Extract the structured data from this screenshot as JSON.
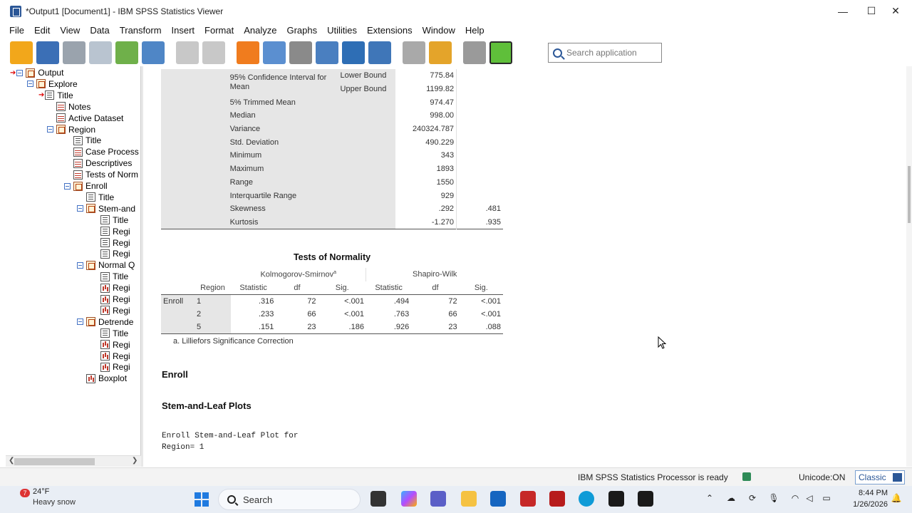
{
  "window": {
    "title": "*Output1 [Document1] - IBM SPSS Statistics Viewer",
    "minimize": "—",
    "maximize": "☐",
    "close": "✕"
  },
  "menu": [
    "File",
    "Edit",
    "View",
    "Data",
    "Transform",
    "Insert",
    "Format",
    "Analyze",
    "Graphs",
    "Utilities",
    "Extensions",
    "Window",
    "Help"
  ],
  "toolbar": {
    "search_placeholder": "Search application",
    "icons": [
      "open-folder-icon",
      "save-icon",
      "print-icon",
      "print-preview-icon",
      "export-icon",
      "recall-dialog-icon",
      "undo-icon",
      "redo-icon",
      "goto-data-icon",
      "goto-case-icon",
      "variables-icon",
      "split-file-icon",
      "select-cases-icon",
      "value-labels-icon",
      "designate-window-icon",
      "show-all-icon",
      "hide-icon",
      "insert-output-icon"
    ]
  },
  "outline": {
    "items": [
      {
        "label": "Output",
        "type": "book",
        "level": 0,
        "expander": true,
        "arrow": true
      },
      {
        "label": "Explore",
        "type": "book",
        "level": 1,
        "expander": true
      },
      {
        "label": "Title",
        "type": "page",
        "level": 2,
        "arrow": true
      },
      {
        "label": "Notes",
        "type": "tbl",
        "level": 2
      },
      {
        "label": "Active Dataset",
        "type": "tbl",
        "level": 2
      },
      {
        "label": "Region",
        "type": "book",
        "level": 2,
        "expander": true
      },
      {
        "label": "Title",
        "type": "page",
        "level": 3
      },
      {
        "label": "Case Process",
        "type": "tbl",
        "level": 3
      },
      {
        "label": "Descriptives",
        "type": "tbl",
        "level": 3
      },
      {
        "label": "Tests of Norm",
        "type": "tbl",
        "level": 3
      },
      {
        "label": "Enroll",
        "type": "book",
        "level": 3,
        "expander": true
      },
      {
        "label": "Title",
        "type": "page",
        "level": 4
      },
      {
        "label": "Stem-and",
        "type": "book",
        "level": 4,
        "expander": true
      },
      {
        "label": "Title",
        "type": "page",
        "level": 5
      },
      {
        "label": "Regi",
        "type": "page",
        "level": 5
      },
      {
        "label": "Regi",
        "type": "page",
        "level": 5
      },
      {
        "label": "Regi",
        "type": "page",
        "level": 5
      },
      {
        "label": "Normal Q",
        "type": "book",
        "level": 4,
        "expander": true
      },
      {
        "label": "Title",
        "type": "page",
        "level": 5
      },
      {
        "label": "Regi",
        "type": "chart",
        "level": 5
      },
      {
        "label": "Regi",
        "type": "chart",
        "level": 5
      },
      {
        "label": "Regi",
        "type": "chart",
        "level": 5
      },
      {
        "label": "Detrende",
        "type": "book",
        "level": 4,
        "expander": true
      },
      {
        "label": "Title",
        "type": "page",
        "level": 5
      },
      {
        "label": "Regi",
        "type": "chart",
        "level": 5
      },
      {
        "label": "Regi",
        "type": "chart",
        "level": 5
      },
      {
        "label": "Regi",
        "type": "chart",
        "level": 5
      },
      {
        "label": "Boxplot",
        "type": "chart",
        "level": 4
      }
    ]
  },
  "descriptives": {
    "rows": [
      {
        "label": "95% Confidence Interval for Mean",
        "sub": "Lower Bound",
        "stat": "775.84",
        "se": ""
      },
      {
        "label": "",
        "sub": "Upper Bound",
        "stat": "1199.82",
        "se": ""
      },
      {
        "label": "5% Trimmed Mean",
        "sub": "",
        "stat": "974.47",
        "se": ""
      },
      {
        "label": "Median",
        "sub": "",
        "stat": "998.00",
        "se": ""
      },
      {
        "label": "Variance",
        "sub": "",
        "stat": "240324.787",
        "se": ""
      },
      {
        "label": "Std. Deviation",
        "sub": "",
        "stat": "490.229",
        "se": ""
      },
      {
        "label": "Minimum",
        "sub": "",
        "stat": "343",
        "se": ""
      },
      {
        "label": "Maximum",
        "sub": "",
        "stat": "1893",
        "se": ""
      },
      {
        "label": "Range",
        "sub": "",
        "stat": "1550",
        "se": ""
      },
      {
        "label": "Interquartile Range",
        "sub": "",
        "stat": "929",
        "se": ""
      },
      {
        "label": "Skewness",
        "sub": "",
        "stat": ".292",
        "se": ".481"
      },
      {
        "label": "Kurtosis",
        "sub": "",
        "stat": "-1.270",
        "se": ".935"
      }
    ]
  },
  "normality": {
    "title": "Tests of Normality",
    "group1": "Kolmogorov-Smirnov",
    "group1_sup": "a",
    "group2": "Shapiro-Wilk",
    "region_header": "Region",
    "col_headers": [
      "Statistic",
      "df",
      "Sig.",
      "Statistic",
      "df",
      "Sig."
    ],
    "variable": "Enroll",
    "rows": [
      {
        "region": "1",
        "ks_stat": ".316",
        "ks_df": "72",
        "ks_sig": "<.001",
        "sw_stat": ".494",
        "sw_df": "72",
        "sw_sig": "<.001"
      },
      {
        "region": "2",
        "ks_stat": ".233",
        "ks_df": "66",
        "ks_sig": "<.001",
        "sw_stat": ".763",
        "sw_df": "66",
        "sw_sig": "<.001"
      },
      {
        "region": "5",
        "ks_stat": ".151",
        "ks_df": "23",
        "ks_sig": ".186",
        "sw_stat": ".926",
        "sw_df": "23",
        "sw_sig": ".088"
      }
    ],
    "footnote": "a. Lilliefors Significance Correction"
  },
  "sections": {
    "enroll_heading": "Enroll",
    "stem_heading": "Stem-and-Leaf Plots",
    "stem_line1": "Enroll Stem-and-Leaf Plot for",
    "stem_line2": "Region= 1"
  },
  "statusbar": {
    "ready": "IBM SPSS Statistics Processor is ready",
    "unicode": "Unicode:ON",
    "classic": "Classic"
  },
  "taskbar": {
    "weather_badge": "7",
    "temp": "24°F",
    "weather": "Heavy snow",
    "search": "Search",
    "time": "8:44 PM",
    "date": "1/26/2026"
  }
}
